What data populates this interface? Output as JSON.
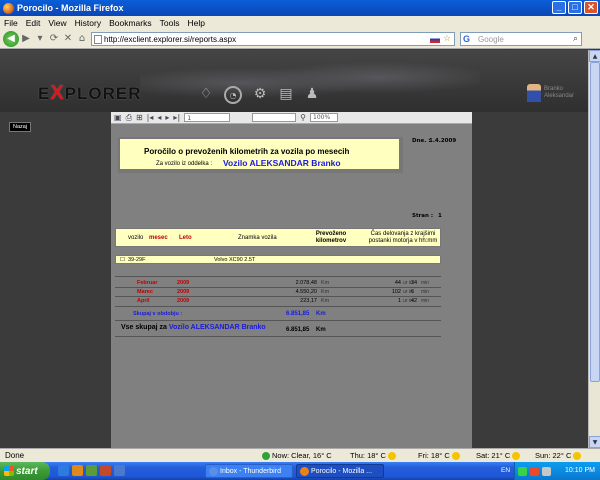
{
  "window": {
    "title": "Porocilo - Mozilla Firefox",
    "min": "_",
    "max": "□",
    "close": "✕"
  },
  "menu": [
    "File",
    "Edit",
    "View",
    "History",
    "Bookmarks",
    "Tools",
    "Help"
  ],
  "nav": {
    "url": "http://exclient.explorer.si/reports.aspx",
    "search_placeholder": "Google",
    "search_engine": "G"
  },
  "header": {
    "logo_pre": "E",
    "logo_x": "X",
    "logo_post": "PLORER",
    "user_line1": "Branko",
    "user_line2": "Aleksandar"
  },
  "nazaj": "Nazaj",
  "report_toolbar": {
    "page_value": "1",
    "zoom": "100%"
  },
  "report": {
    "title": "Poročilo o prevoženih kilometrih za vozila po mesecih",
    "for_label": "Za vozilo iz oddelka :",
    "for_value": "Vozilo ALEKSANDAR Branko",
    "date_label": "Dne. :",
    "date_value": "1.4.2009",
    "page_label": "Stran :",
    "page_value": "1",
    "columns": {
      "vozilo": "vozilo",
      "mesec": "mesec",
      "leto": "Leto",
      "znamka": "Znamka vozila",
      "prevozeno": "Prevoženo kilometrov",
      "cas": "Čas delovanja z krajšimi postanki motorja v hh:mm"
    },
    "vehicle": {
      "plate": "39-29F",
      "model": "Volvo XC90 2.5T"
    },
    "rows": [
      {
        "month": "Februar",
        "year": "2009",
        "km": "2.078,48",
        "km_unit": "Km",
        "hours": "44",
        "h_unit": "ur in",
        "minutes": "34",
        "m_unit": "min"
      },
      {
        "month": "Marec",
        "year": "2009",
        "km": "4.550,20",
        "km_unit": "Km",
        "hours": "102",
        "h_unit": "ur in",
        "minutes": "6",
        "m_unit": "min"
      },
      {
        "month": "April",
        "year": "2009",
        "km": "223,17",
        "km_unit": "Km",
        "hours": "1",
        "h_unit": "ur in",
        "minutes": "42",
        "m_unit": "min"
      }
    ],
    "subtotal_label": "Skupaj v obdobju :",
    "subtotal_value": "6.851,85",
    "subtotal_unit": "Km",
    "total_label": "Vse skupaj za",
    "total_target": "Vozilo ALEKSANDAR Branko",
    "total_value": "6.851,85",
    "total_unit": "Km"
  },
  "status": {
    "done": "Done",
    "now": "Now: Clear, 16° C",
    "thu": "Thu: 18° C",
    "fri": "Fri: 18° C",
    "sat": "Sat: 21° C",
    "sun": "Sun: 22° C"
  },
  "taskbar": {
    "start": "start",
    "task1": "Inbox - Thunderbird",
    "task2": "Porocilo - Mozilla ...",
    "lang": "EN",
    "clock": "10:10 PM"
  },
  "colors": {
    "accent_blue": "#1a1ae0",
    "accent_red": "#c00000",
    "report_bg": "#808080",
    "box_yellow": "#ffffc0"
  }
}
